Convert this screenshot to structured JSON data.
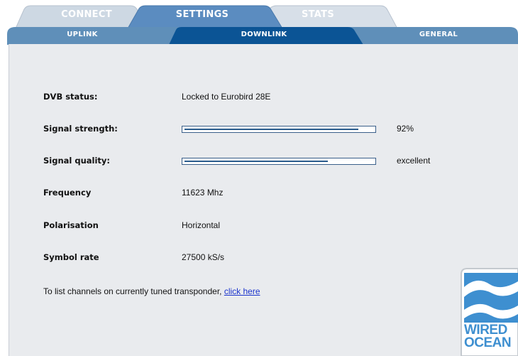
{
  "top_tabs": [
    {
      "label": "CONNECT",
      "active": false
    },
    {
      "label": "SETTINGS",
      "active": true
    },
    {
      "label": "STATS",
      "active": false
    }
  ],
  "sub_tabs": [
    {
      "label": "UPLINK",
      "active": false
    },
    {
      "label": "DOWNLINK",
      "active": true
    },
    {
      "label": "GENERAL",
      "active": false
    }
  ],
  "status": {
    "dvb_label": "DVB status:",
    "dvb_value": "Locked to Eurobird 28E",
    "strength_label": "Signal strength:",
    "strength_fraction": 0.92,
    "strength_text": "92%",
    "quality_label": "Signal quality:",
    "quality_fraction": 0.76,
    "quality_text": "excellent",
    "frequency_label": "Frequency",
    "frequency_value": "11623 Mhz",
    "polarisation_label": "Polarisation",
    "polarisation_value": "Horizontal",
    "symbol_rate_label": "Symbol rate",
    "symbol_rate_value": "27500 kS/s"
  },
  "footer": {
    "text": "To list channels on currently tuned transponder, ",
    "link": "click here"
  },
  "logo": {
    "line1": "WIRED",
    "line2": "OCEAN"
  },
  "colors": {
    "tab_blue": "#9db6ce",
    "tab_active": "#3b74ac",
    "subtab_active": "#0b5495",
    "panel_bg": "#e9ebee",
    "meter_fill": "#2a5b8c",
    "link": "#1a33cc"
  }
}
